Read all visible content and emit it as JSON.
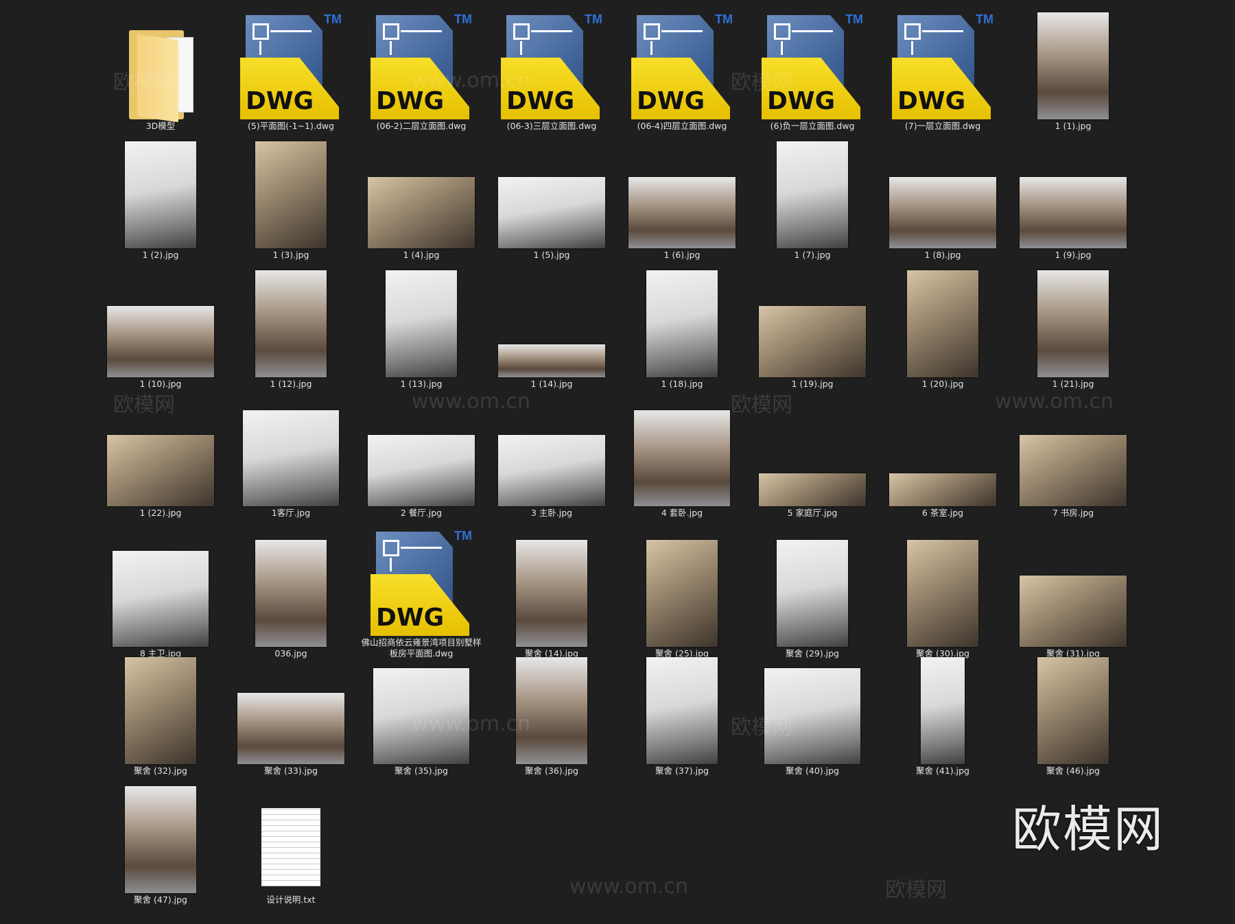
{
  "items": [
    {
      "kind": "folder",
      "label": "3D模型"
    },
    {
      "kind": "dwg",
      "label": "(5)平面图(-1~1).dwg"
    },
    {
      "kind": "dwg",
      "label": "(06-2)二层立面图.dwg"
    },
    {
      "kind": "dwg",
      "label": "(06-3)三层立面图.dwg"
    },
    {
      "kind": "dwg",
      "label": "(06-4)四层立面图.dwg"
    },
    {
      "kind": "dwg",
      "label": "(6)负一层立面图.dwg"
    },
    {
      "kind": "dwg",
      "label": "(7)一层立面图.dwg"
    },
    {
      "kind": "img",
      "shape": "P",
      "tone": "t2",
      "label": "1 (1).jpg"
    },
    {
      "kind": "img",
      "shape": "P",
      "tone": "t1",
      "label": "1 (2).jpg"
    },
    {
      "kind": "img",
      "shape": "P",
      "tone": "t3",
      "label": "1 (3).jpg"
    },
    {
      "kind": "img",
      "shape": "L",
      "tone": "t3",
      "label": "1 (4).jpg"
    },
    {
      "kind": "img",
      "shape": "L",
      "tone": "t1",
      "label": "1 (5).jpg"
    },
    {
      "kind": "img",
      "shape": "L",
      "tone": "t2",
      "label": "1 (6).jpg"
    },
    {
      "kind": "img",
      "shape": "P",
      "tone": "t1",
      "label": "1 (7).jpg"
    },
    {
      "kind": "img",
      "shape": "L",
      "tone": "t2",
      "label": "1 (8).jpg"
    },
    {
      "kind": "img",
      "shape": "L",
      "tone": "t2",
      "label": "1 (9).jpg"
    },
    {
      "kind": "img",
      "shape": "L",
      "tone": "t2",
      "label": "1 (10).jpg"
    },
    {
      "kind": "img",
      "shape": "P",
      "tone": "t2",
      "label": "1 (12).jpg"
    },
    {
      "kind": "img",
      "shape": "P",
      "tone": "t1",
      "label": "1 (13).jpg"
    },
    {
      "kind": "img",
      "shape": "W",
      "tone": "t2",
      "label": "1 (14).jpg"
    },
    {
      "kind": "img",
      "shape": "P",
      "tone": "t1",
      "label": "1 (18).jpg"
    },
    {
      "kind": "img",
      "shape": "L",
      "tone": "t3",
      "label": "1 (19).jpg"
    },
    {
      "kind": "img",
      "shape": "P",
      "tone": "t3",
      "label": "1 (20).jpg"
    },
    {
      "kind": "img",
      "shape": "P",
      "tone": "t2",
      "label": "1 (21).jpg"
    },
    {
      "kind": "img",
      "shape": "L",
      "tone": "t3",
      "label": "1 (22).jpg"
    },
    {
      "kind": "img",
      "shape": "S",
      "tone": "t1",
      "label": "1客厅.jpg"
    },
    {
      "kind": "img",
      "shape": "L",
      "tone": "t1",
      "label": "2 餐厅.jpg"
    },
    {
      "kind": "img",
      "shape": "L",
      "tone": "t1",
      "label": "3 主卧.jpg"
    },
    {
      "kind": "img",
      "shape": "S",
      "tone": "t2",
      "label": "4 套卧.jpg"
    },
    {
      "kind": "img",
      "shape": "W",
      "tone": "t3",
      "label": "5 家庭厅.jpg"
    },
    {
      "kind": "img",
      "shape": "W",
      "tone": "t3",
      "label": "6 茶室.jpg"
    },
    {
      "kind": "img",
      "shape": "L",
      "tone": "t3",
      "label": "7 书房.jpg"
    },
    {
      "kind": "img",
      "shape": "S",
      "tone": "t1",
      "label": "8 主卫.jpg"
    },
    {
      "kind": "img",
      "shape": "P",
      "tone": "t2",
      "label": "036.jpg"
    },
    {
      "kind": "dwg",
      "label": "佛山招商依云雍景湾项目别墅样板房平面图.dwg"
    },
    {
      "kind": "img",
      "shape": "P",
      "tone": "t2",
      "label": "聚舍 (14).jpg"
    },
    {
      "kind": "img",
      "shape": "P",
      "tone": "t3",
      "label": "聚舍 (25).jpg"
    },
    {
      "kind": "img",
      "shape": "P",
      "tone": "t1",
      "label": "聚舍 (29).jpg"
    },
    {
      "kind": "img",
      "shape": "P",
      "tone": "t3",
      "label": "聚舍 (30).jpg"
    },
    {
      "kind": "img",
      "shape": "L",
      "tone": "t3",
      "label": "聚舍 (31).jpg"
    },
    {
      "kind": "img",
      "shape": "P",
      "tone": "t3",
      "label": "聚舍 (32).jpg"
    },
    {
      "kind": "img",
      "shape": "L",
      "tone": "t2",
      "label": "聚舍 (33).jpg"
    },
    {
      "kind": "img",
      "shape": "S",
      "tone": "t1",
      "label": "聚舍 (35).jpg"
    },
    {
      "kind": "img",
      "shape": "P",
      "tone": "t2",
      "label": "聚舍 (36).jpg"
    },
    {
      "kind": "img",
      "shape": "P",
      "tone": "t1",
      "label": "聚舍 (37).jpg"
    },
    {
      "kind": "img",
      "shape": "S",
      "tone": "t1",
      "label": "聚舍 (40).jpg"
    },
    {
      "kind": "img",
      "shape": "N",
      "tone": "t1",
      "label": "聚舍 (41).jpg"
    },
    {
      "kind": "img",
      "shape": "P",
      "tone": "t3",
      "label": "聚舍 (46).jpg"
    },
    {
      "kind": "img",
      "shape": "P",
      "tone": "t2",
      "label": "聚舍 (47).jpg"
    },
    {
      "kind": "txt",
      "label": "设计说明.txt"
    }
  ],
  "dwg_icon_text": "DWG",
  "dwg_tm": "TM",
  "watermark": {
    "brand": "欧模网",
    "url": "www.om.cn"
  }
}
